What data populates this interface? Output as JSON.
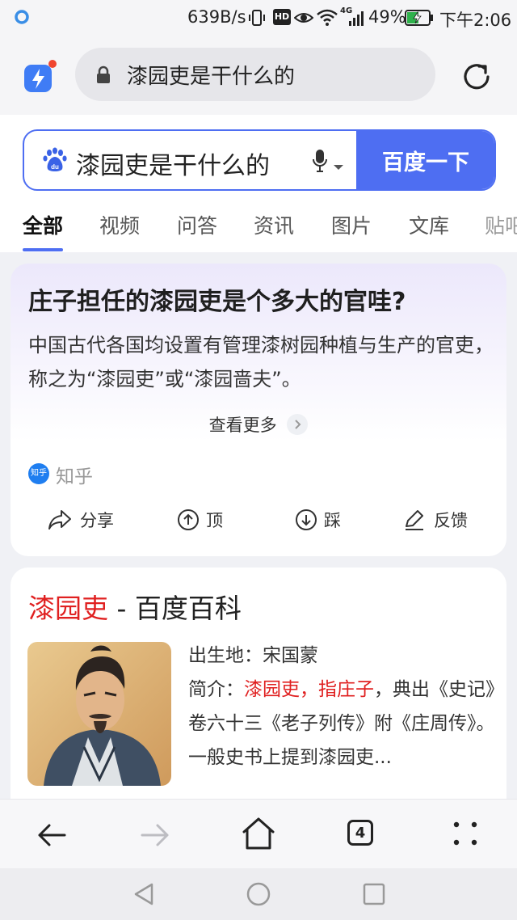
{
  "status_bar": {
    "network_speed": "639B/s",
    "hd_badge": "HD",
    "network_type": "4G",
    "battery": "49%",
    "time": "下午2:06"
  },
  "browser": {
    "url_text": "漆园吏是干什么的"
  },
  "search": {
    "query": "漆园吏是干什么的",
    "button_label": "百度一下",
    "logo_text": "du",
    "tabs": [
      "全部",
      "视频",
      "问答",
      "资讯",
      "图片",
      "文库",
      "贴吧"
    ]
  },
  "answer_card": {
    "title": "庄子担任的漆园吏是个多大的官哇?",
    "body": "中国古代各国均设置有管理漆树园种植与生产的官吏，称之为“漆园吏”或“漆园啬夫”。",
    "see_more": "查看更多",
    "source_badge": "知乎",
    "source_name": "知乎",
    "actions": {
      "share": "分享",
      "up": "顶",
      "down": "踩",
      "feedback": "反馈"
    }
  },
  "baike_card": {
    "title_highlight": "漆园吏",
    "title_rest": " - 百度百科",
    "birthplace_label": "出生地：",
    "birthplace_value": "宋国蒙",
    "intro_label": "简介：",
    "intro_highlight": "漆园吏，指庄子",
    "intro_rest": "，典出《史记》卷六十三《老子列传》附《庄周传》。一般史书上提到漆园吏..."
  },
  "toolbar": {
    "tab_count": "4"
  },
  "colors": {
    "accent": "#4e6ef2",
    "highlight_red": "#e02020",
    "zhihu_blue": "#1f7ef0"
  }
}
